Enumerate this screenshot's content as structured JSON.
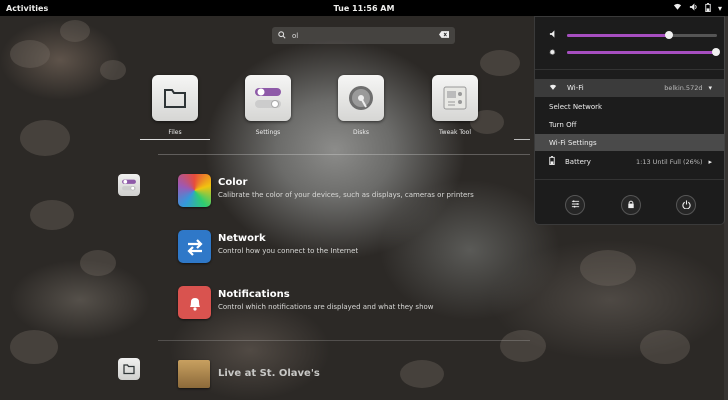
{
  "topbar": {
    "activities": "Activities",
    "clock": "Tue 11:56 AM"
  },
  "search": {
    "query": "ol"
  },
  "apps": [
    {
      "label": "Files",
      "icon": "files-icon"
    },
    {
      "label": "Settings",
      "icon": "settings-icon"
    },
    {
      "label": "Disks",
      "icon": "disks-icon"
    },
    {
      "label": "Tweak Tool",
      "icon": "tweak-tool-icon"
    }
  ],
  "results": [
    {
      "title": "Color",
      "desc": "Calibrate the color of your devices, such as displays, cameras or printers",
      "icon": "color-icon"
    },
    {
      "title": "Network",
      "desc": "Control how you connect to the Internet",
      "icon": "network-icon"
    },
    {
      "title": "Notifications",
      "desc": "Control which notifications are displayed and what they show",
      "icon": "notifications-icon"
    }
  ],
  "folder": {
    "title": "Live at St. Olave's"
  },
  "system_menu": {
    "volume_level": 0.68,
    "brightness_level": 0.99,
    "wifi_label": "Wi-Fi",
    "wifi_network": "belkin.572d",
    "select_network": "Select Network",
    "turn_off": "Turn Off",
    "wifi_settings": "Wi-Fi Settings",
    "battery_label": "Battery",
    "battery_status": "1:13 Until Full (26%)"
  },
  "colors": {
    "accent": "#a64ec0",
    "menu_bg": "#1c1c1c",
    "topbar_bg": "#000000"
  }
}
